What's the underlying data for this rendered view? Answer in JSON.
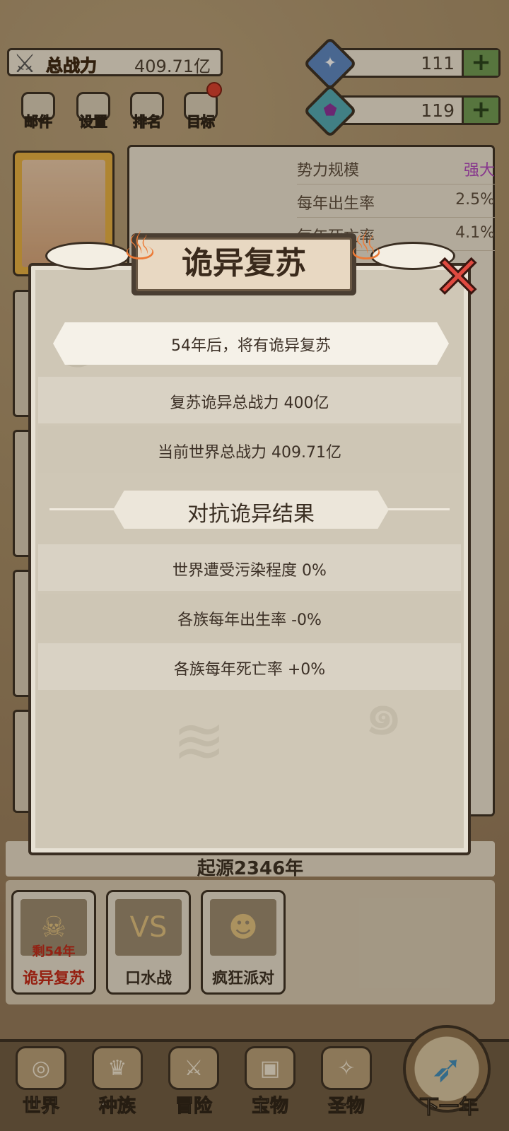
{
  "header": {
    "power_label": "总战力",
    "power_value": "409.71亿",
    "resource_1": "111",
    "resource_2": "119",
    "plus": "+"
  },
  "menu": [
    {
      "label": "邮件"
    },
    {
      "label": "设置"
    },
    {
      "label": "排名"
    },
    {
      "label": "目标"
    }
  ],
  "stats": [
    {
      "key": "势力规模",
      "value": "强大"
    },
    {
      "key": "每年出生率",
      "value": "2.5%"
    },
    {
      "key": "每年死亡率",
      "value": "4.1%"
    }
  ],
  "era_text": "起源2346年",
  "events": [
    {
      "sub": "剩54年",
      "name": "诡异复苏"
    },
    {
      "name": "口水战"
    },
    {
      "name": "疯狂派对"
    }
  ],
  "bottom_nav": [
    {
      "label": "世界"
    },
    {
      "label": "种族"
    },
    {
      "label": "冒险"
    },
    {
      "label": "宝物"
    },
    {
      "label": "圣物"
    }
  ],
  "next_year": "下一年",
  "modal": {
    "title": "诡异复苏",
    "banner": "54年后，将有诡异复苏",
    "rows_top": [
      "复苏诡异总战力  400亿",
      "当前世界总战力  409.71亿"
    ],
    "section_title": "对抗诡异结果",
    "rows_bottom": [
      "世界遭受污染程度 0%",
      "各族每年出生率 -0%",
      "各族每年死亡率 +0%"
    ]
  },
  "colors": {
    "strong": "#b044c0",
    "event_active": "#c42414",
    "plus_button": "#6e9a52"
  }
}
